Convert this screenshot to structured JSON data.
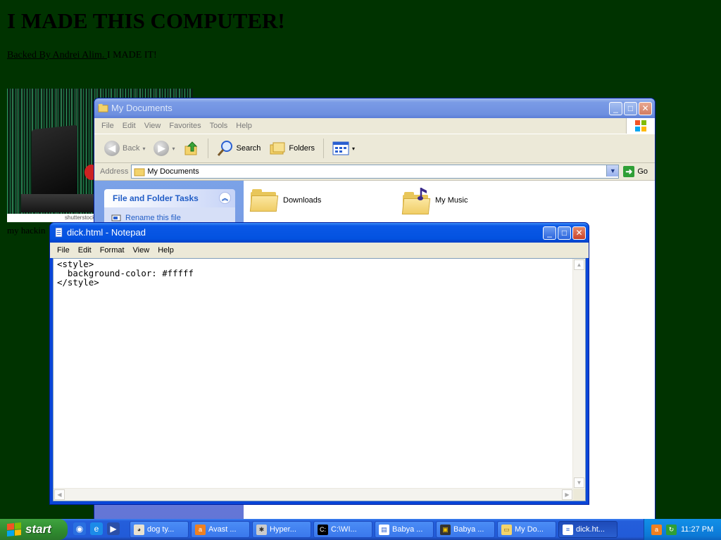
{
  "webpage": {
    "heading": "I MADE THIS COMPUTER!",
    "subtitle_prefix": "Backed By Andrei Alim. ",
    "subtitle_suffix": "I MADE IT!",
    "image_caption": "shutterstock",
    "link_text": "my hackin"
  },
  "my_documents": {
    "title": "My Documents",
    "menu": [
      "File",
      "Edit",
      "View",
      "Favorites",
      "Tools",
      "Help"
    ],
    "toolbar": {
      "back": "Back",
      "search": "Search",
      "folders": "Folders"
    },
    "address_label": "Address",
    "address_value": "My Documents",
    "go_label": "Go",
    "task_panel_title": "File and Folder Tasks",
    "task_rename": "Rename this file",
    "items": [
      {
        "label": "Downloads",
        "icon": "folder-icon"
      },
      {
        "label": "My Music",
        "icon": "music-folder-icon"
      }
    ]
  },
  "notepad": {
    "title": "dick.html - Notepad",
    "menu": [
      "File",
      "Edit",
      "Format",
      "View",
      "Help"
    ],
    "content": "<style>\n  background-color: #fffff\n</style>"
  },
  "taskbar": {
    "start_label": "start",
    "tasks": [
      {
        "label": "dog ty...",
        "icon": "dog-icon"
      },
      {
        "label": "Avast ...",
        "icon": "avast-icon"
      },
      {
        "label": "Hyper...",
        "icon": "hyperterminal-icon"
      },
      {
        "label": "C:\\WI...",
        "icon": "cmd-icon"
      },
      {
        "label": "Babya ...",
        "icon": "document-icon"
      },
      {
        "label": "Babya ...",
        "icon": "movie-icon"
      },
      {
        "label": "My Do...",
        "icon": "folder-icon"
      },
      {
        "label": "dick.ht...",
        "icon": "notepad-icon",
        "active": true
      }
    ],
    "clock": "11:27 PM"
  },
  "colors": {
    "desktop_bg": "#003300",
    "xp_blue": "#0a46d8",
    "start_green": "#3fa33f"
  }
}
